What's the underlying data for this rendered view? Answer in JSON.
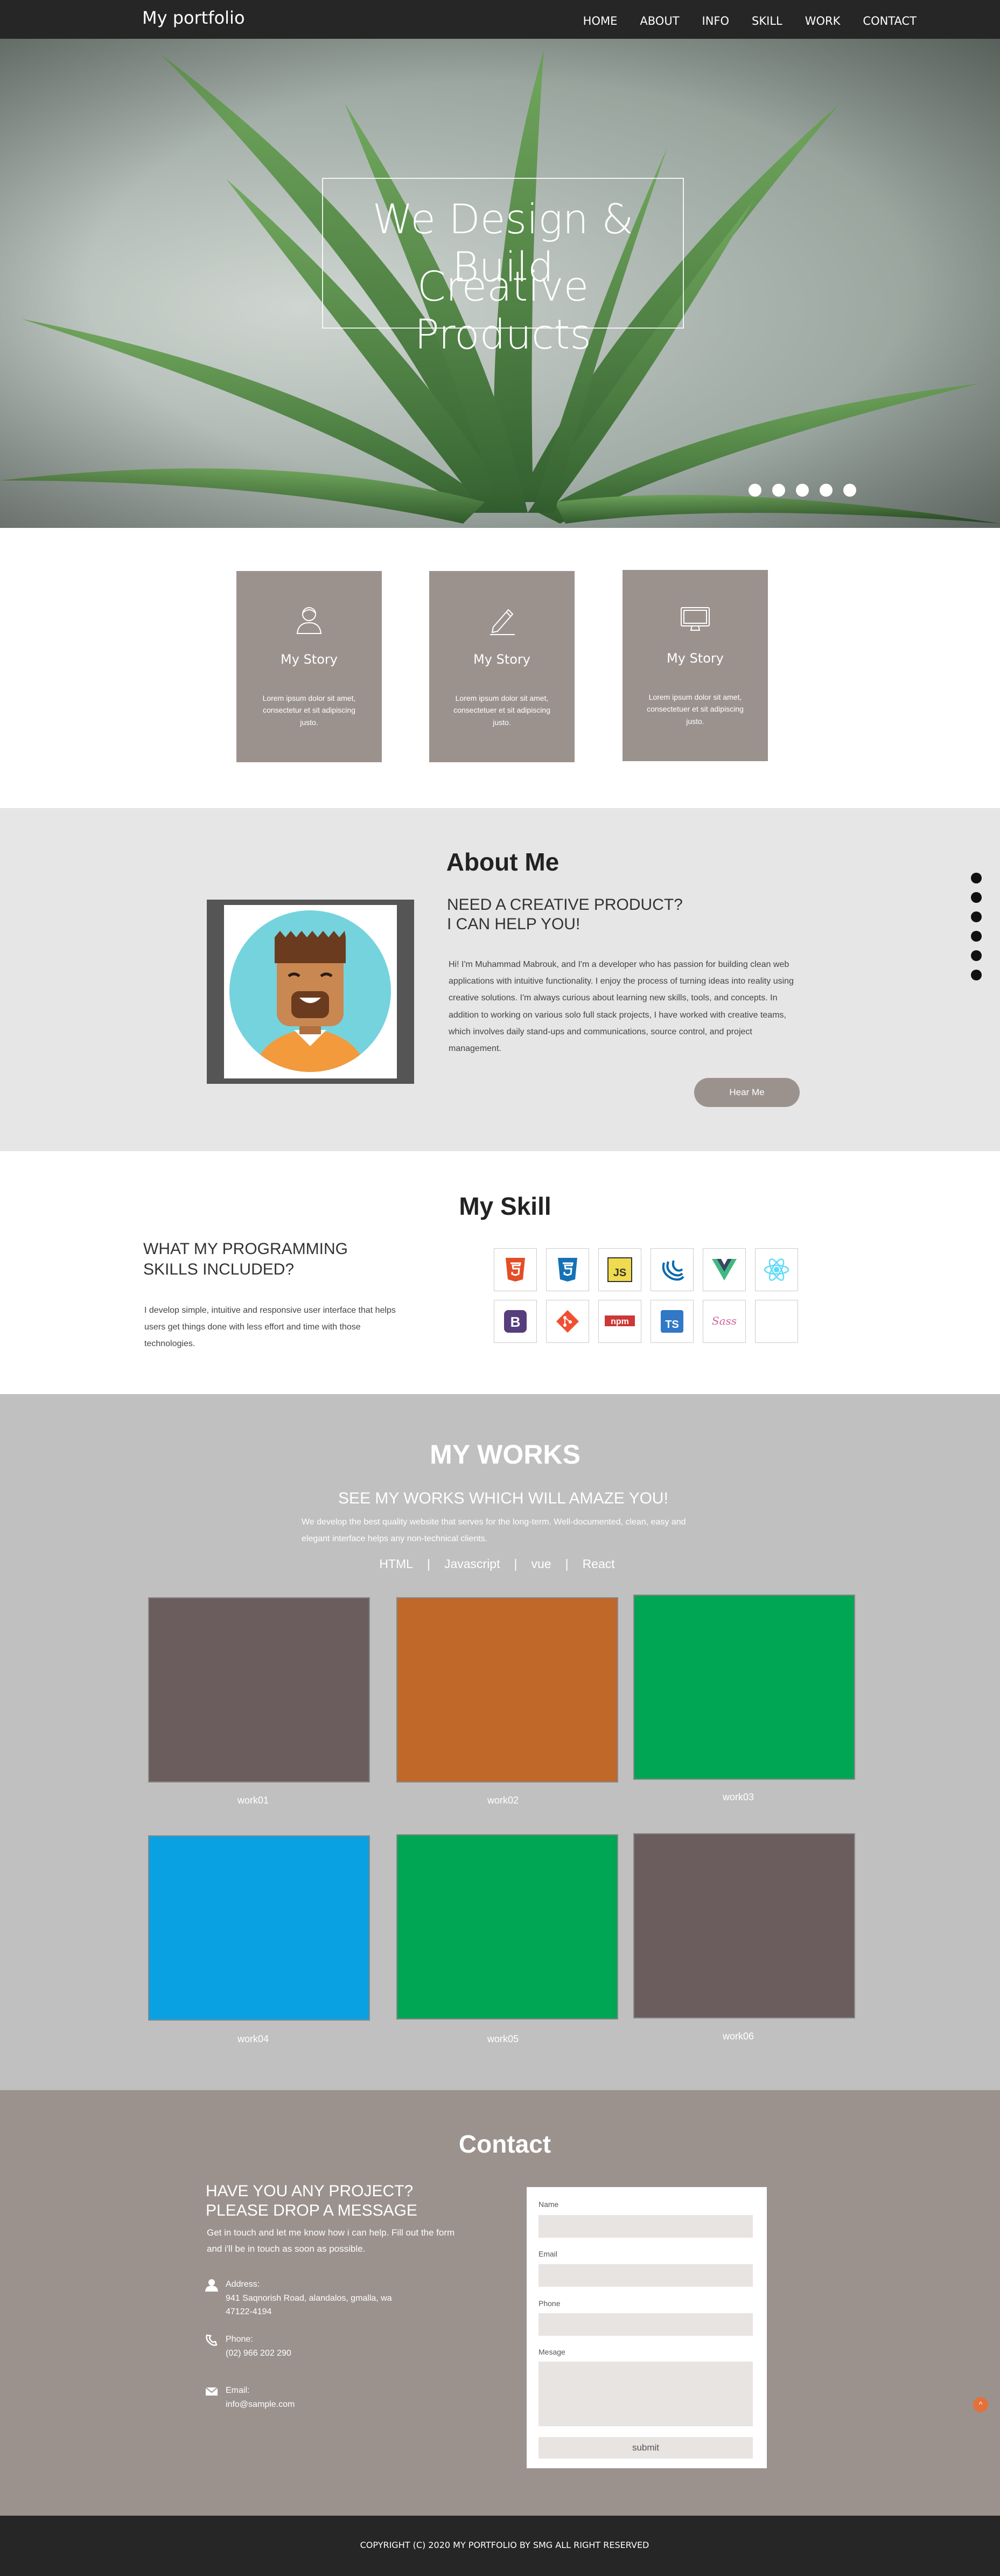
{
  "nav": {
    "brand": "My portfolio",
    "items": [
      "HOME",
      "ABOUT",
      "INFO",
      "SKILL",
      "WORK",
      "CONTACT"
    ]
  },
  "hero": {
    "line1": "We Design & Build",
    "line2": "Creative Products",
    "slide_count": 5
  },
  "services": {
    "cards": [
      {
        "icon": "user-icon",
        "title": "My Story",
        "text": "Lorem ipsum dolor sit amet, consectetur et sit adipiscing justo."
      },
      {
        "icon": "pencil-icon",
        "title": "My Story",
        "text": "Lorem ipsum dolor sit amet, consectetuer et sit adipiscing justo."
      },
      {
        "icon": "monitor-icon",
        "title": "My Story",
        "text": "Lorem ipsum dolor sit amet, consectetuer et sit adipiscing justo."
      }
    ]
  },
  "about": {
    "title": "About Me",
    "heading_line1": "NEED A CREATIVE PRODUCT?",
    "heading_line2": "I CAN HELP YOU!",
    "bio": "Hi! I'm Muhammad Mabrouk, and I'm a developer who has passion for building clean web applications with intuitive functionality. I enjoy the process of turning ideas into reality using creative solutions. I'm always curious about learning new skills, tools, and concepts. In addition to working on various solo full stack projects, I have worked with creative teams, which involves daily stand-ups and communications, source control, and project management.",
    "hire_button": "Hear Me"
  },
  "side_nav_count": 6,
  "skills": {
    "title": "My Skill",
    "heading_line1": "WHAT MY PROGRAMMING",
    "heading_line2": "SKILLS INCLUDED?",
    "description": "I develop simple, intuitive and responsive user interface that helps users get things done with less effort and time with those technologies.",
    "icons": [
      "html5-icon",
      "css3-icon",
      "javascript-icon",
      "jquery-icon",
      "vue-icon",
      "react-icon",
      "bootstrap-icon",
      "git-icon",
      "npm-icon",
      "typescript-icon",
      "sass-icon",
      "empty-slot"
    ],
    "icon_text": {
      "js": "JS",
      "npm": "npm",
      "ts": "TS",
      "sass": "Sass",
      "bootstrap": "B"
    }
  },
  "works": {
    "title": "MY WORKS",
    "subtitle": "SEE MY WORKS WHICH WILL AMAZE YOU!",
    "description": "We develop the best quality website that serves for the long-term. Well-documented, clean, easy and elegant interface helps any non-technical clients.",
    "filters": [
      "HTML",
      "Javascript",
      "vue",
      "React"
    ],
    "separator": "|",
    "items": [
      {
        "label": "work01",
        "color": "#6b5d5d"
      },
      {
        "label": "work02",
        "color": "#c0672a"
      },
      {
        "label": "work03",
        "color": "#00a653"
      },
      {
        "label": "work04",
        "color": "#0aa1e2"
      },
      {
        "label": "work05",
        "color": "#00a653"
      },
      {
        "label": "work06",
        "color": "#6b5d5d"
      }
    ]
  },
  "contact": {
    "title": "Contact",
    "heading_line1": "HAVE YOU ANY PROJECT?",
    "heading_line2": "PLEASE DROP A MESSAGE",
    "lead": "Get in touch and let me know how i can help. Fill out the form and i'll be in touch as soon as possible.",
    "address_label": "Address:",
    "address_line1": "941 Saqnorish Road, alandalos, gmalla, wa",
    "address_line2": "47122-4194",
    "phone_label": "Phone:",
    "phone": "(02) 966 202 290",
    "email_label": "Email:",
    "email": "info@sample.com",
    "form": {
      "name_label": "Name",
      "email_label": "Email",
      "phone_label": "Phone",
      "message_label": "Mesage",
      "submit": "submit"
    },
    "to_top": "^"
  },
  "footer": {
    "copyright": "COPYRIGHT (C) 2020 MY PORTFOLIO BY SMG ALL RIGHT RESERVED"
  },
  "colors": {
    "nav_bg": "#262626",
    "card_bg": "#9b928e",
    "about_bg": "#e6e6e6",
    "works_bg": "#c0c0c0",
    "contact_bg": "#9b928e",
    "accent": "#e4703a"
  }
}
